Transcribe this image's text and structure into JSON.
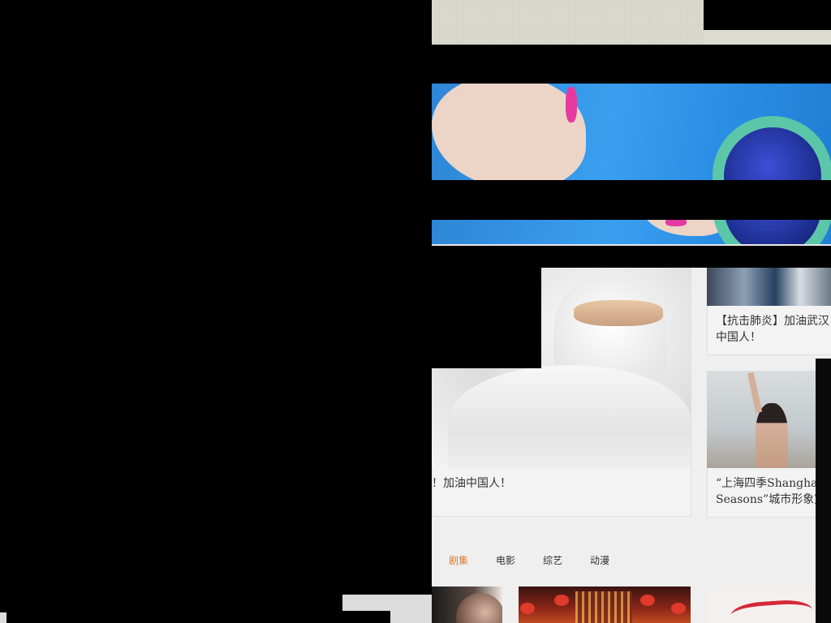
{
  "featured": {
    "main_title": "！加油中国人！",
    "side1_title": "【抗击肺炎】加油武汉中国人！",
    "side1_line1": "【抗击肺炎】加油武汉",
    "side1_line2": "中国人！",
    "side2_line1": "“上海四季Shanghai,",
    "side2_line2": "Seasons”城市形象宣"
  },
  "tabs": [
    {
      "label": "剧集",
      "active": true
    },
    {
      "label": "电影",
      "active": false
    },
    {
      "label": "综艺",
      "active": false
    },
    {
      "label": "动漫",
      "active": false
    }
  ],
  "colors": {
    "tab_active": "#e07b2c",
    "text": "#333333",
    "card_bg": "#f3f3f3"
  }
}
